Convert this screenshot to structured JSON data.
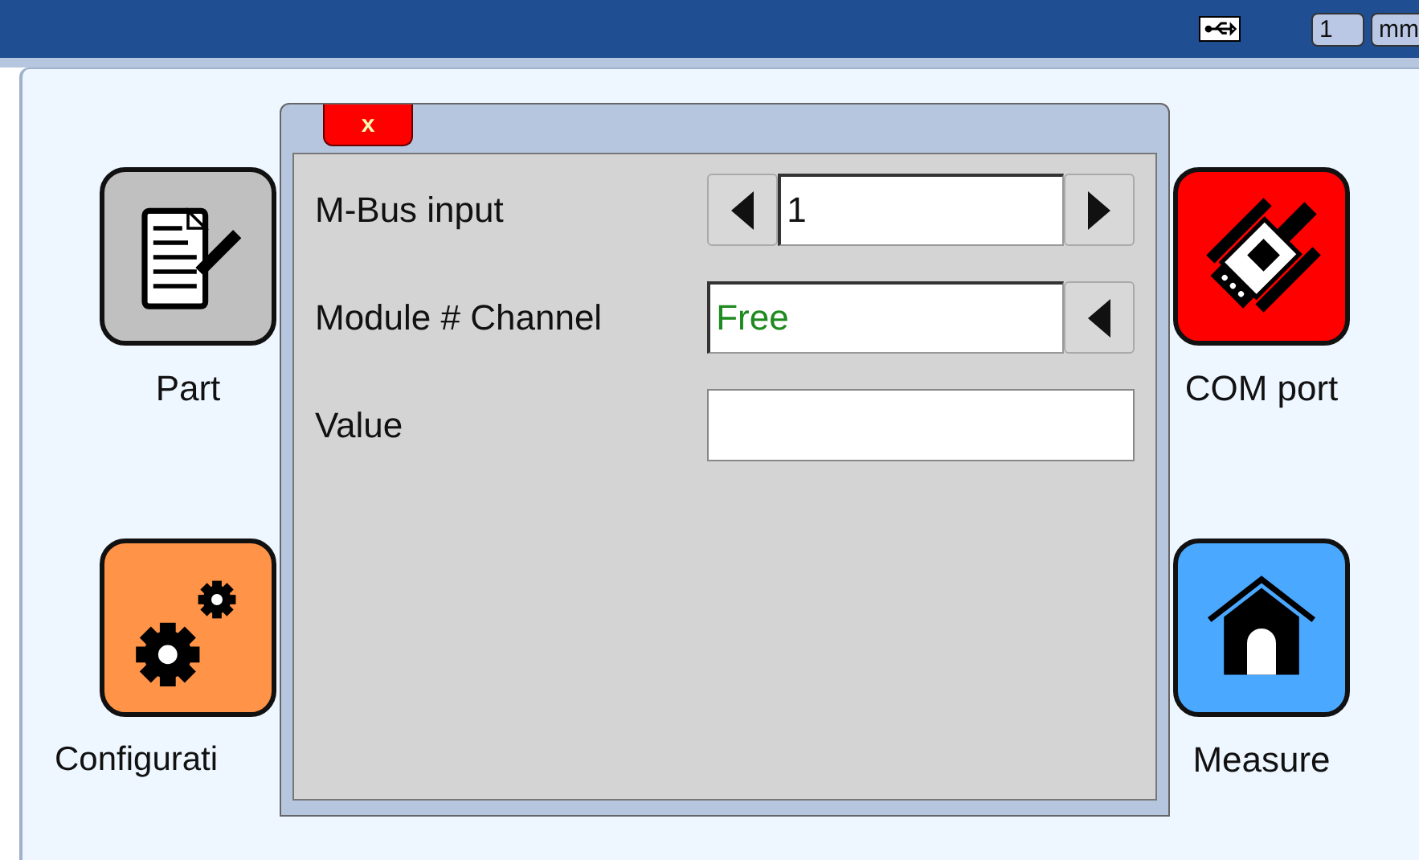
{
  "status_bar": {
    "unit_value": "1",
    "unit": "mm"
  },
  "tiles": [
    {
      "label": "Part",
      "kind": "document",
      "color": "#c0c0c0"
    },
    {
      "label": "COM port",
      "kind": "connector",
      "color": "#ff0000"
    },
    {
      "label": "Configurati",
      "kind": "gears",
      "color": "#ff9347"
    },
    {
      "label": "Measure",
      "kind": "house",
      "color": "#4aa8ff"
    }
  ],
  "dialog": {
    "close": "x",
    "fields": [
      {
        "label": "M-Bus input",
        "kind": "spinner",
        "value": "1"
      },
      {
        "label": "Module # Channel",
        "kind": "select",
        "value": "Free"
      },
      {
        "label": "Value",
        "kind": "text"
      }
    ]
  }
}
